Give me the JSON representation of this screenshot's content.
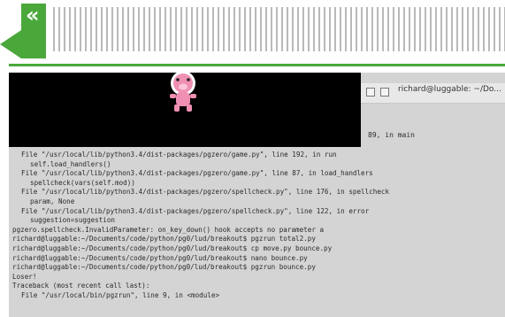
{
  "header": {
    "chevron": "«",
    "accent": "#4aa83b"
  },
  "terminal": {
    "title": "richard@luggable: ~/Do...",
    "top_line": "89, in main",
    "lines": [
      {
        "indent": 1,
        "text": "File \"/usr/local/lib/python3.4/dist-packages/pgzero/game.py\", line 192, in run"
      },
      {
        "indent": 2,
        "text": "self.load_handlers()"
      },
      {
        "indent": 1,
        "text": "File \"/usr/local/lib/python3.4/dist-packages/pgzero/game.py\", line 87, in load_handlers"
      },
      {
        "indent": 2,
        "text": "spellcheck(vars(self.mod))"
      },
      {
        "indent": 1,
        "text": "File \"/usr/local/lib/python3.4/dist-packages/pgzero/spellcheck.py\", line 176, in spellcheck"
      },
      {
        "indent": 2,
        "text": "param, None"
      },
      {
        "indent": 1,
        "text": "File \"/usr/local/lib/python3.4/dist-packages/pgzero/spellcheck.py\", line 122, in error"
      },
      {
        "indent": 2,
        "text": "suggestion=suggestion"
      },
      {
        "indent": 0,
        "text": "pgzero.spellcheck.InvalidParameter: on_key_down() hook accepts no parameter a"
      },
      {
        "indent": 0,
        "text": "richard@luggable:~/Documents/code/python/pg0/lud/breakout$ pgzrun total2.py"
      },
      {
        "indent": 0,
        "text": "richard@luggable:~/Documents/code/python/pg0/lud/breakout$ cp move.py bounce.py"
      },
      {
        "indent": 0,
        "text": "richard@luggable:~/Documents/code/python/pg0/lud/breakout$ nano bounce.py"
      },
      {
        "indent": 0,
        "text": "richard@luggable:~/Documents/code/python/pg0/lud/breakout$ pgzrun bounce.py"
      },
      {
        "indent": 0,
        "text": "Loser!"
      },
      {
        "indent": 0,
        "text": "Traceback (most recent call last):"
      },
      {
        "indent": 1,
        "text": "File \"/usr/local/bin/pgzrun\", line 9, in <module>"
      }
    ]
  },
  "game": {
    "background": "#000000",
    "sprite_color": "#f08fb4"
  }
}
